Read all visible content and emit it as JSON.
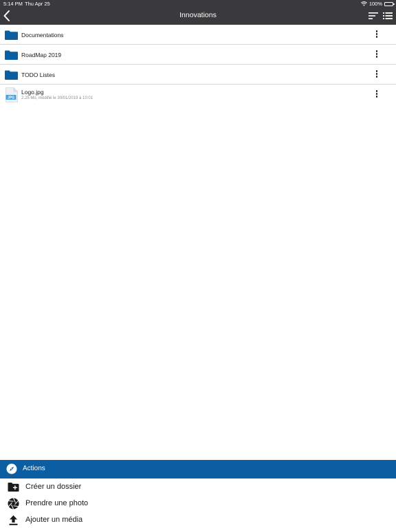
{
  "status_bar": {
    "time": "5:14 PM",
    "date": "Thu Apr 25",
    "battery": "100%"
  },
  "nav": {
    "title": "Innovations"
  },
  "items": [
    {
      "type": "folder",
      "name": "Documentations"
    },
    {
      "type": "folder",
      "name": "RoadMap 2019"
    },
    {
      "type": "folder",
      "name": "TODO Listes"
    },
    {
      "type": "file",
      "name": "Logo.jpg",
      "badge": "JPG",
      "meta": "2.25 Mo, modifié le 30/01/2019 à 10:01"
    }
  ],
  "actions": {
    "header": "Actions",
    "items": [
      {
        "label": "Créer un dossier",
        "icon": "new-folder-icon"
      },
      {
        "label": "Prendre une photo",
        "icon": "camera-aperture-icon"
      },
      {
        "label": "Ajouter un média",
        "icon": "upload-icon"
      }
    ]
  },
  "colors": {
    "nav_bg": "#3a3a3c",
    "accent": "#0b5ea2",
    "folder": "#0b5ea2"
  }
}
